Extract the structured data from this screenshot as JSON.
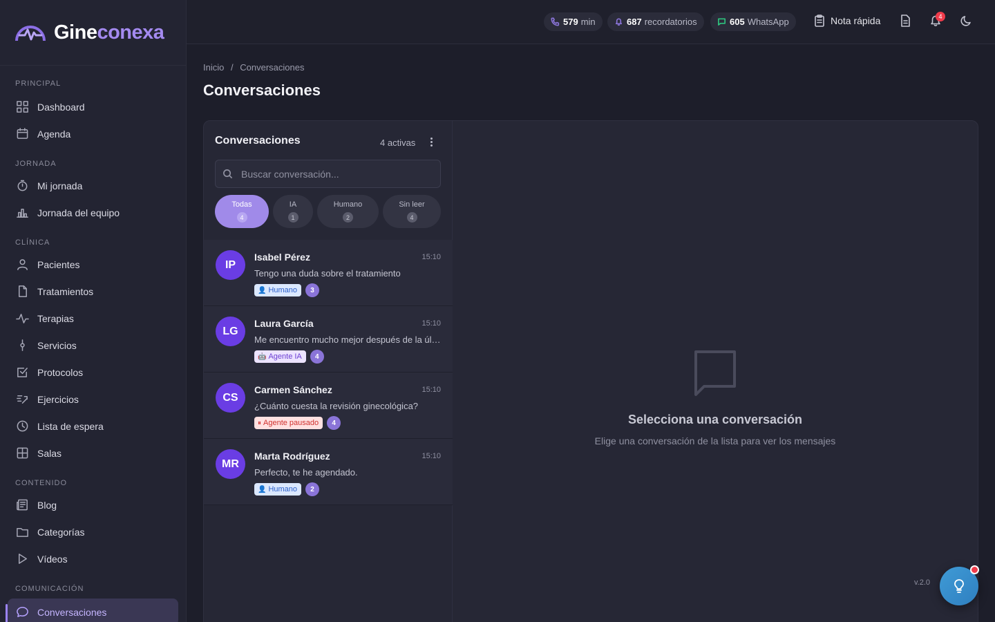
{
  "app": {
    "logo_part1": "Gine",
    "logo_part2": "conexa",
    "version": "v.2.0"
  },
  "sidebar": {
    "sections": [
      {
        "title": "PRINCIPAL",
        "items": [
          {
            "label": "Dashboard",
            "icon": "grid-icon"
          },
          {
            "label": "Agenda",
            "icon": "calendar-icon"
          }
        ]
      },
      {
        "title": "JORNADA",
        "items": [
          {
            "label": "Mi jornada",
            "icon": "stopwatch-icon"
          },
          {
            "label": "Jornada del equipo",
            "icon": "bar-chart-icon"
          }
        ]
      },
      {
        "title": "CLÍNICA",
        "items": [
          {
            "label": "Pacientes",
            "icon": "user-icon"
          },
          {
            "label": "Tratamientos",
            "icon": "file-icon"
          },
          {
            "label": "Terapias",
            "icon": "pulse-icon"
          },
          {
            "label": "Servicios",
            "icon": "git-commit-icon"
          },
          {
            "label": "Protocolos",
            "icon": "checkbox-icon"
          },
          {
            "label": "Ejercicios",
            "icon": "run-icon"
          },
          {
            "label": "Lista de espera",
            "icon": "clock-icon"
          },
          {
            "label": "Salas",
            "icon": "layout-icon"
          }
        ]
      },
      {
        "title": "CONTENIDO",
        "items": [
          {
            "label": "Blog",
            "icon": "newspaper-icon"
          },
          {
            "label": "Categorías",
            "icon": "folder-icon"
          },
          {
            "label": "Vídeos",
            "icon": "play-icon"
          }
        ]
      },
      {
        "title": "COMUNICACIÓN",
        "items": [
          {
            "label": "Conversaciones",
            "icon": "chat-icon",
            "active": true
          }
        ]
      }
    ]
  },
  "topbar": {
    "minutes_value": "579",
    "minutes_unit": "min",
    "reminders_value": "687",
    "reminders_label": "recordatorios",
    "whatsapp_value": "605",
    "whatsapp_label": "WhatsApp",
    "quick_note_label": "Nota rápida",
    "notifications_count": "4"
  },
  "breadcrumb": {
    "home": "Inicio",
    "separator": "/",
    "current": "Conversaciones"
  },
  "page_title": "Conversaciones",
  "conversations_panel": {
    "title": "Conversaciones",
    "active_count_label": "4 activas",
    "search_placeholder": "Buscar conversación...",
    "filters": [
      {
        "label": "Todas",
        "count": "4",
        "active": true
      },
      {
        "label": "IA",
        "count": "1"
      },
      {
        "label": "Humano",
        "count": "2"
      },
      {
        "label": "Sin leer",
        "count": "4"
      }
    ],
    "items": [
      {
        "initials": "IP",
        "name": "Isabel Pérez",
        "time": "15:10",
        "message": "Tengo una duda sobre el tratamiento",
        "tag": "Humano",
        "tag_type": "humano",
        "tag_icon": "👤",
        "unread": "3"
      },
      {
        "initials": "LG",
        "name": "Laura García",
        "time": "15:10",
        "message": "Me encuentro mucho mejor después de la última sesión",
        "tag": "Agente IA",
        "tag_type": "ia",
        "tag_icon": "🤖",
        "unread": "4"
      },
      {
        "initials": "CS",
        "name": "Carmen Sánchez",
        "time": "15:10",
        "message": "¿Cuánto cuesta la revisión ginecológica?",
        "tag": "Agente pausado",
        "tag_type": "paused",
        "tag_icon": "⏸",
        "unread": "4"
      },
      {
        "initials": "MR",
        "name": "Marta Rodríguez",
        "time": "15:10",
        "message": "Perfecto, te he agendado.",
        "tag": "Humano",
        "tag_type": "humano",
        "tag_icon": "👤",
        "unread": "2"
      }
    ]
  },
  "empty_state": {
    "title": "Selecciona una conversación",
    "subtitle": "Elige una conversación de la lista para ver los mensajes"
  },
  "colors": {
    "accent": "#a08ae9",
    "avatar": "#6a3de4",
    "notification": "#ef3b4b",
    "fab": "#3f9bd6"
  }
}
